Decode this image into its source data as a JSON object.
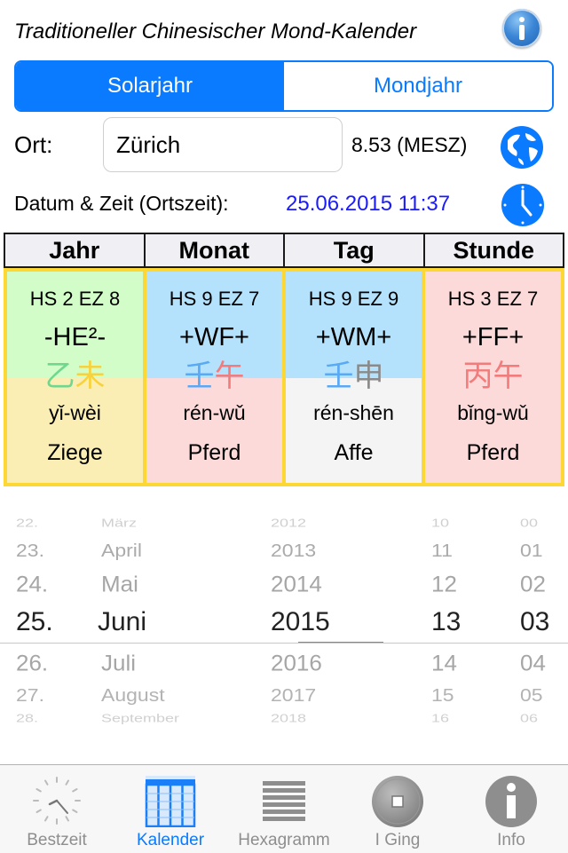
{
  "header": {
    "title": "Traditioneller Chinesischer Mond-Kalender",
    "info_icon": "info-icon"
  },
  "segmented": {
    "options": [
      "Solarjahr",
      "Mondjahr"
    ],
    "selected": "Solarjahr"
  },
  "location": {
    "label": "Ort:",
    "value": "Zürich",
    "timezone": "8.53 (MESZ)",
    "icon": "globe-icon"
  },
  "datetime": {
    "label": "Datum & Zeit (Ortszeit):",
    "value": "25.06.2015 11:37",
    "icon": "clock-icon"
  },
  "colors": {
    "accent": "#0a7aff",
    "date_blue": "#1a1aff",
    "cell_border": "#fdd835",
    "green": "#d2fdc8",
    "blue": "#b4e2fc",
    "yellow": "#faeeb4",
    "pink": "#fddada",
    "grey": "#f4f4f4"
  },
  "table": {
    "headers": [
      "Jahr",
      "Monat",
      "Tag",
      "Stunde"
    ],
    "cells": [
      {
        "hsez": "HS 2  EZ 8",
        "code": "-HE²-",
        "char1": "乙",
        "char1_color": "#6fd88e",
        "char2": "未",
        "char2_color": "#f8d23c",
        "pinyin": "yǐ-wèi",
        "animal": "Ziege",
        "top_bg": "#d2fdc8",
        "bottom_bg": "#faeeb4"
      },
      {
        "hsez": "HS 9  EZ 7",
        "code": "+WF+",
        "char1": "壬",
        "char1_color": "#5aa9f5",
        "char2": "午",
        "char2_color": "#f27c7c",
        "pinyin": "rén-wǔ",
        "animal": "Pferd",
        "top_bg": "#b4e2fc",
        "bottom_bg": "#fddada"
      },
      {
        "hsez": "HS 9  EZ 9",
        "code": "+WM+",
        "char1": "壬",
        "char1_color": "#5aa9f5",
        "char2": "申",
        "char2_color": "#8a8a8a",
        "pinyin": "rén-shēn",
        "animal": "Affe",
        "top_bg": "#b4e2fc",
        "bottom_bg": "#f4f4f4"
      },
      {
        "hsez": "HS 3  EZ 7",
        "code": "+FF+",
        "char1": "丙",
        "char1_color": "#f27c7c",
        "char2": "午",
        "char2_color": "#f27c7c",
        "pinyin": "bǐng-wǔ",
        "animal": "Pferd",
        "top_bg": "#fddada",
        "bottom_bg": "#fddada"
      }
    ]
  },
  "picker": {
    "columns": [
      {
        "name": "day",
        "items": [
          "22.",
          "23.",
          "24.",
          "25.",
          "26.",
          "27.",
          "28."
        ],
        "selected": "25."
      },
      {
        "name": "month",
        "items": [
          "März",
          "April",
          "Mai",
          "Juni",
          "Juli",
          "August",
          "September"
        ],
        "selected": "Juni"
      },
      {
        "name": "year",
        "items": [
          "2012",
          "2013",
          "2014",
          "2015",
          "2016",
          "2017",
          "2018"
        ],
        "selected": "2015"
      },
      {
        "name": "hour",
        "items": [
          "10",
          "11",
          "12",
          "13",
          "14",
          "15",
          "16"
        ],
        "selected": "13"
      },
      {
        "name": "minute",
        "items": [
          "00",
          "01",
          "02",
          "03",
          "04",
          "05",
          "06"
        ],
        "selected": "03"
      }
    ]
  },
  "tabbar": {
    "tabs": [
      {
        "label": "Bestzeit",
        "icon": "clock-face-icon",
        "active": false
      },
      {
        "label": "Kalender",
        "icon": "calendar-grid-icon",
        "active": true
      },
      {
        "label": "Hexagramm",
        "icon": "hexagram-lines-icon",
        "active": false
      },
      {
        "label": "I Ging",
        "icon": "coin-icon",
        "active": false
      },
      {
        "label": "Info",
        "icon": "info-icon",
        "active": false
      }
    ]
  }
}
